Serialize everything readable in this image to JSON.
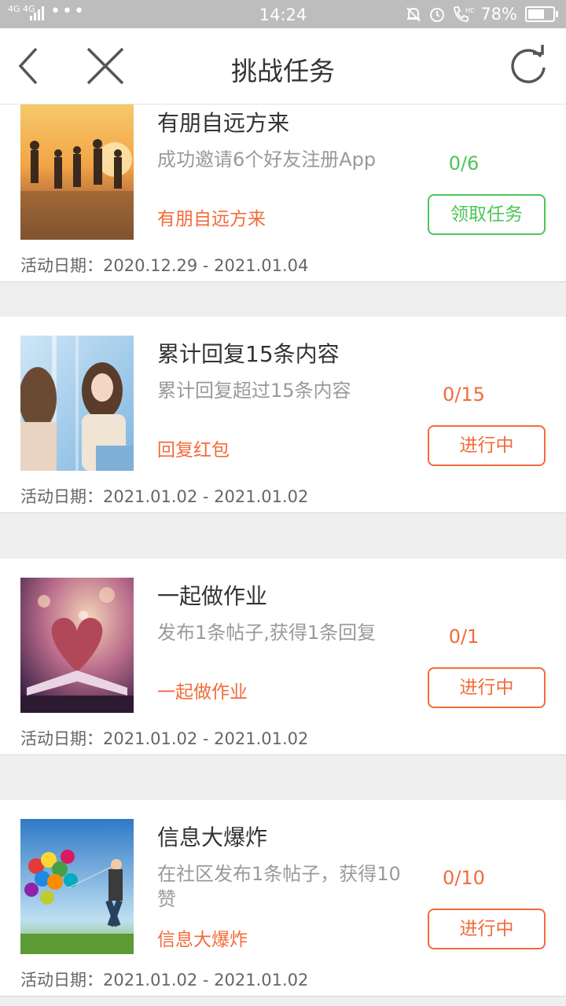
{
  "status_bar": {
    "network": "4G 4G",
    "dots": "•••",
    "time": "14:24",
    "battery_text": "78%",
    "battery_level": 0.78
  },
  "nav": {
    "title": "挑战任务",
    "back_icon": "chevron-left-icon",
    "close_icon": "close-icon",
    "refresh_icon": "refresh-icon"
  },
  "colors": {
    "accent_orange": "#f26b3a",
    "accent_green": "#4cc65a"
  },
  "tasks": [
    {
      "title": "有朋自远方来",
      "description": "成功邀请6个好友注册App",
      "tag": "有朋自远方来",
      "progress": "0/6",
      "button": "领取任务",
      "date_label": "活动日期：",
      "date_range": "2020.12.29 - 2021.01.04",
      "image": "friends-beach-sunset"
    },
    {
      "title": "累计回复15条内容",
      "description": "累计回复超过15条内容",
      "tag": "回复红包",
      "progress": "0/15",
      "button": "进行中",
      "date_label": "活动日期：",
      "date_range": "2021.01.02 - 2021.01.02",
      "image": "two-girls-chatting"
    },
    {
      "title": "一起做作业",
      "description": "发布1条帖子,获得1条回复",
      "tag": "一起做作业",
      "progress": "0/1",
      "button": "进行中",
      "date_label": "活动日期：",
      "date_range": "2021.01.02 - 2021.01.02",
      "image": "heart-book-pages"
    },
    {
      "title": "信息大爆炸",
      "description": "在社区发布1条帖子，获得10赞",
      "tag": "信息大爆炸",
      "progress": "0/10",
      "button": "进行中",
      "date_label": "活动日期：",
      "date_range": "2021.01.02 - 2021.01.02",
      "image": "balloons-boy-jumping"
    }
  ]
}
